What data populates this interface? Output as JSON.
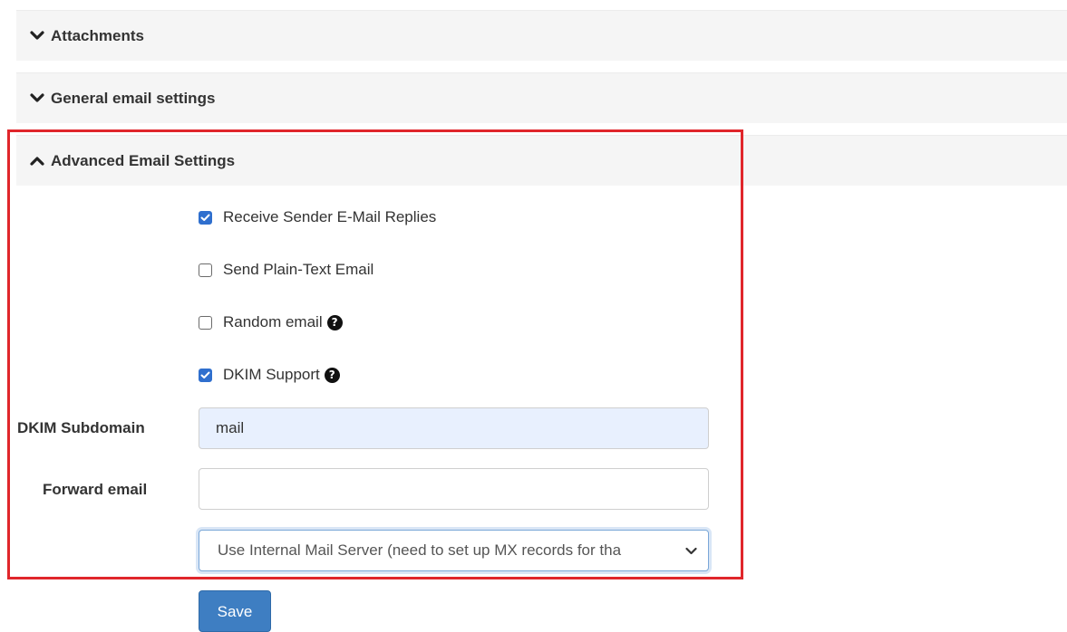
{
  "sections": {
    "attachments": {
      "title": "Attachments",
      "state": "collapsed"
    },
    "general": {
      "title": "General email settings",
      "state": "collapsed"
    },
    "advanced": {
      "title": "Advanced Email Settings",
      "state": "expanded"
    }
  },
  "checkboxes": {
    "receive_replies": {
      "label": "Receive Sender E-Mail Replies",
      "checked": true
    },
    "plain_text": {
      "label": "Send Plain-Text Email",
      "checked": false
    },
    "random_email": {
      "label": "Random email",
      "checked": false,
      "help_icon": "question-circle"
    },
    "dkim_support": {
      "label": "DKIM Support",
      "checked": true,
      "help_icon": "question-circle"
    }
  },
  "fields": {
    "dkim_subdomain": {
      "label": "DKIM Subdomain",
      "value": "mail"
    },
    "forward_email": {
      "label": "Forward email",
      "value": ""
    }
  },
  "mail_server_select": {
    "selected": "Use Internal Mail Server (need to set up MX records for tha"
  },
  "buttons": {
    "save": "Save"
  },
  "colors": {
    "highlight_border": "#e0262b",
    "primary_button": "#3e7ec2",
    "checkbox_checked": "#2f6fce",
    "panel_header_bg": "#f5f5f5",
    "autofill_bg": "#e8f0fe"
  }
}
